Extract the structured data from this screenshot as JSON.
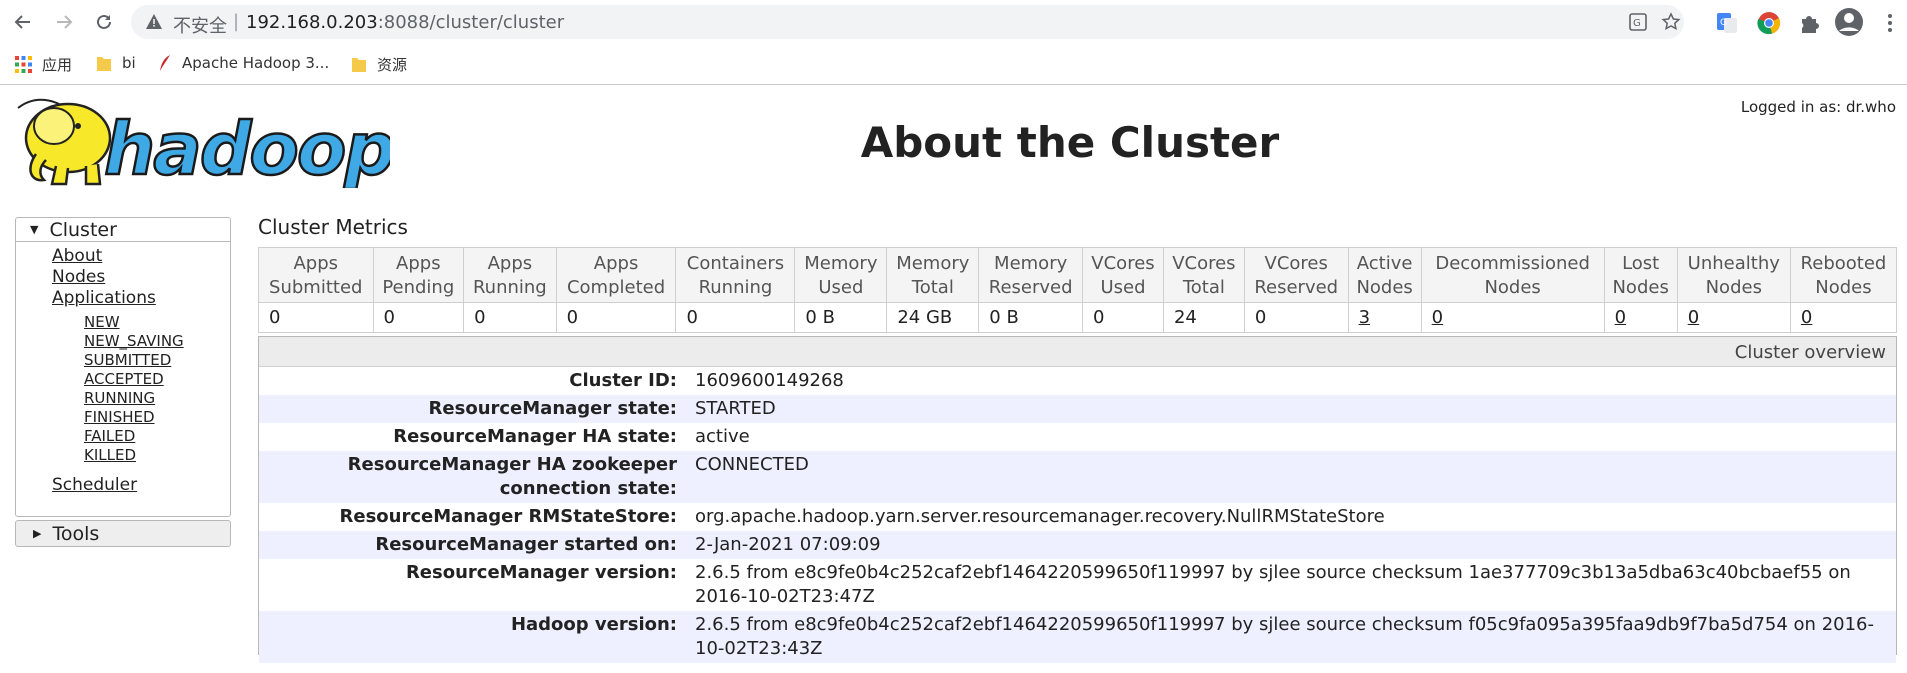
{
  "browser": {
    "insecure_label": "不安全",
    "url_host": "192.168.0.203",
    "url_path": ":8088/cluster/cluster",
    "bookmarks": [
      {
        "label": "应用",
        "icon": "apps-grid-icon"
      },
      {
        "label": "bi",
        "icon": "folder-icon"
      },
      {
        "label": "Apache Hadoop 3...",
        "icon": "feather-icon"
      },
      {
        "label": "资源",
        "icon": "folder-icon"
      }
    ]
  },
  "header": {
    "title": "About the Cluster",
    "logged_in": "Logged in as: dr.who"
  },
  "sidebar": {
    "cluster_label": "Cluster",
    "links": [
      "About",
      "Nodes",
      "Applications"
    ],
    "app_states": [
      "NEW",
      "NEW_SAVING",
      "SUBMITTED",
      "ACCEPTED",
      "RUNNING",
      "FINISHED",
      "FAILED",
      "KILLED"
    ],
    "scheduler": "Scheduler",
    "tools_label": "Tools"
  },
  "metrics": {
    "title": "Cluster Metrics",
    "headers": [
      [
        "Apps",
        "Submitted"
      ],
      [
        "Apps",
        "Pending"
      ],
      [
        "Apps",
        "Running"
      ],
      [
        "Apps",
        "Completed"
      ],
      [
        "Containers",
        "Running"
      ],
      [
        "Memory",
        "Used"
      ],
      [
        "Memory",
        "Total"
      ],
      [
        "Memory",
        "Reserved"
      ],
      [
        "VCores",
        "Used"
      ],
      [
        "VCores",
        "Total"
      ],
      [
        "VCores",
        "Reserved"
      ],
      [
        "Active",
        "Nodes"
      ],
      [
        "Decommissioned",
        "Nodes"
      ],
      [
        "Lost",
        "Nodes"
      ],
      [
        "Unhealthy",
        "Nodes"
      ],
      [
        "Rebooted",
        "Nodes"
      ]
    ],
    "values": [
      "0",
      "0",
      "0",
      "0",
      "0",
      "0 B",
      "24 GB",
      "0 B",
      "0",
      "24",
      "0",
      "3",
      "0",
      "0",
      "0",
      "0"
    ]
  },
  "overview": {
    "title": "Cluster overview",
    "rows": [
      {
        "label": "Cluster ID:",
        "value": "1609600149268"
      },
      {
        "label": "ResourceManager state:",
        "value": "STARTED"
      },
      {
        "label": "ResourceManager HA state:",
        "value": "active"
      },
      {
        "label": "ResourceManager HA zookeeper connection state:",
        "value": "CONNECTED"
      },
      {
        "label": "ResourceManager RMStateStore:",
        "value": "org.apache.hadoop.yarn.server.resourcemanager.recovery.NullRMStateStore"
      },
      {
        "label": "ResourceManager started on:",
        "value": "2-Jan-2021 07:09:09"
      },
      {
        "label": "ResourceManager version:",
        "value": "2.6.5 from e8c9fe0b4c252caf2ebf1464220599650f119997 by sjlee source checksum 1ae377709c3b13a5dba63c40bcbaef55 on 2016-10-02T23:47Z"
      },
      {
        "label": "Hadoop version:",
        "value": "2.6.5 from e8c9fe0b4c252caf2ebf1464220599650f119997 by sjlee source checksum f05c9fa095a395faa9db9f7ba5d754 on 2016-10-02T23:43Z"
      }
    ]
  },
  "logo_text": "hadoop",
  "colors": {
    "logo_blue": "#3fa9e6",
    "elephant_yellow": "#f7e92a",
    "link": "#222222"
  }
}
